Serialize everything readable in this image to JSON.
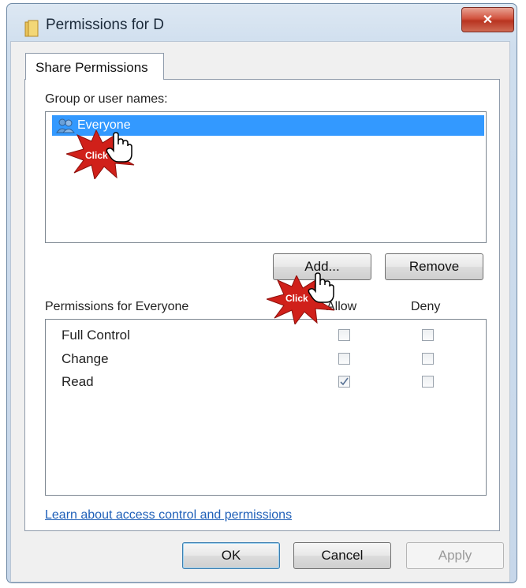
{
  "window": {
    "title": "Permissions for D",
    "close_label": "✕"
  },
  "tabs": [
    {
      "label": "Share Permissions"
    }
  ],
  "group_section": {
    "label": "Group or user names:",
    "items": [
      {
        "name": "Everyone",
        "selected": true
      }
    ]
  },
  "group_buttons": {
    "add_label": "Add...",
    "remove_label": "Remove"
  },
  "permissions_section": {
    "label": "Permissions for Everyone",
    "allow_header": "Allow",
    "deny_header": "Deny",
    "rows": [
      {
        "name": "Full Control",
        "allow": false,
        "deny": false
      },
      {
        "name": "Change",
        "allow": false,
        "deny": false
      },
      {
        "name": "Read",
        "allow": true,
        "deny": false
      }
    ]
  },
  "help_link": "Learn about access control and permissions",
  "dialog_buttons": {
    "ok_label": "OK",
    "cancel_label": "Cancel",
    "apply_label": "Apply"
  },
  "callouts": [
    {
      "text": "Click"
    },
    {
      "text": "Click"
    }
  ],
  "colors": {
    "selection": "#3399ff",
    "link": "#1e5fb8",
    "callout_red": "#d0201a"
  }
}
